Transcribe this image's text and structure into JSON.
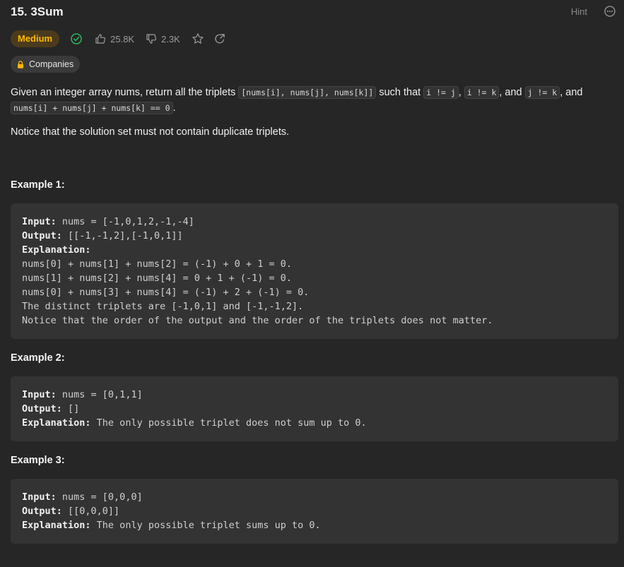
{
  "problem": {
    "title": "15. 3Sum",
    "hint_label": "Hint",
    "difficulty": "Medium",
    "likes": "25.8K",
    "dislikes": "2.3K",
    "companies_label": "Companies"
  },
  "description": {
    "p1_text1": "Given an integer array nums, return all the triplets ",
    "p1_code1": "[nums[i], nums[j], nums[k]]",
    "p1_text2": " such that ",
    "p1_code2": "i != j",
    "p1_text3": ", ",
    "p1_code3": "i != k",
    "p1_text4": ", and ",
    "p1_code4": "j != k",
    "p1_text5": ", and",
    "p1_code5": "nums[i] + nums[j] + nums[k] == 0",
    "p1_text6": ".",
    "notice": "Notice that the solution set must not contain duplicate triplets."
  },
  "examples": [
    {
      "title": "Example 1:",
      "input_label": "Input:",
      "input": " nums = [-1,0,1,2,-1,-4]",
      "output_label": "Output:",
      "output": " [[-1,-1,2],[-1,0,1]]",
      "explanation_label": "Explanation:",
      "explanation_lines": [
        "nums[0] + nums[1] + nums[2] = (-1) + 0 + 1 = 0.",
        "nums[1] + nums[2] + nums[4] = 0 + 1 + (-1) = 0.",
        "nums[0] + nums[3] + nums[4] = (-1) + 2 + (-1) = 0.",
        "The distinct triplets are [-1,0,1] and [-1,-1,2].",
        "Notice that the order of the output and the order of the triplets does not matter."
      ]
    },
    {
      "title": "Example 2:",
      "input_label": "Input:",
      "input": " nums = [0,1,1]",
      "output_label": "Output:",
      "output": " []",
      "explanation_label": "Explanation:",
      "explanation": " The only possible triplet does not sum up to 0."
    },
    {
      "title": "Example 3:",
      "input_label": "Input:",
      "input": " nums = [0,0,0]",
      "output_label": "Output:",
      "output": " [[0,0,0]]",
      "explanation_label": "Explanation:",
      "explanation": " The only possible triplet sums up to 0."
    }
  ],
  "colors": {
    "background": "#262626",
    "difficulty_text": "#ffb800",
    "difficulty_bg": "#4b3b1c",
    "solved_check": "#2db55d"
  },
  "icons": [
    "more-icon",
    "check-circle-icon",
    "thumbs-up-icon",
    "thumbs-down-icon",
    "star-icon",
    "share-icon",
    "lock-icon"
  ]
}
